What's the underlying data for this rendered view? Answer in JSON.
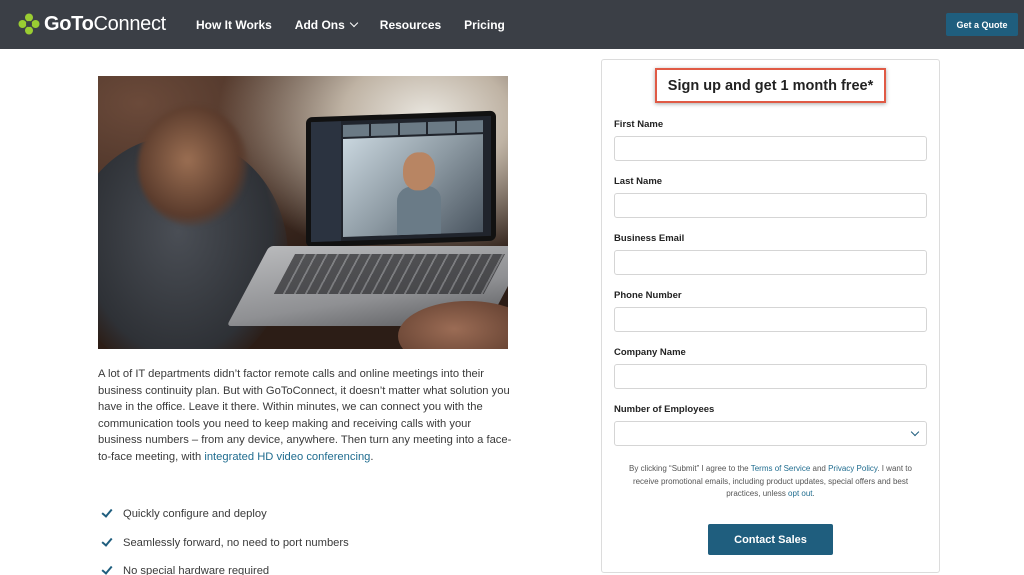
{
  "nav": {
    "logo_bold": "GoTo",
    "logo_light": "Connect",
    "links": [
      {
        "label": "How It Works",
        "icon": ""
      },
      {
        "label": "Add Ons",
        "icon": "chevron-down-icon"
      },
      {
        "label": "Resources",
        "icon": ""
      },
      {
        "label": "Pricing",
        "icon": ""
      }
    ],
    "cta": "Get a Quote"
  },
  "intro": {
    "text": "A lot of IT departments didn’t factor remote calls and online meetings into their business continuity plan. But with GoToConnect, it doesn’t matter what solution you have in the office. Leave it there. Within minutes, we can connect you with the communication tools you need to keep making and receiving calls with your business numbers – from any device, anywhere. Then turn any meeting into a face-to-face meeting, with ",
    "link": "integrated HD video conferencing",
    "end": "."
  },
  "bullets": [
    "Quickly configure and deploy",
    "Seamlessly forward, no need to port numbers",
    "No special hardware required"
  ],
  "form": {
    "headline": "Sign up and get 1 month free*",
    "fields": [
      {
        "label": "First Name",
        "value": ""
      },
      {
        "label": "Last Name",
        "value": ""
      },
      {
        "label": "Business Email",
        "value": ""
      },
      {
        "label": "Phone Number",
        "value": ""
      },
      {
        "label": "Company Name",
        "value": ""
      },
      {
        "label": "Number of Employees",
        "value": ""
      }
    ],
    "consent": {
      "p1": "By clicking “Submit” I agree to the ",
      "terms": "Terms of Service",
      "and": " and ",
      "privacy": "Privacy Policy",
      "p2": ". I want to receive promotional emails, including product updates, special offers and best practices, unless ",
      "optout": "opt out",
      "p3": "."
    },
    "submit": "Contact Sales"
  },
  "colors": {
    "nav_bg": "#3b3f46",
    "accent": "#1f5e7e",
    "highlight_border": "#e05a45",
    "logo_mark": "#9acd32"
  }
}
